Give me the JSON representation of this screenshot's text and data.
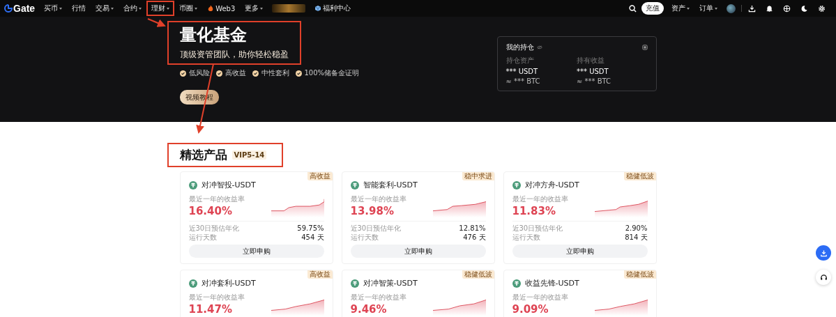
{
  "nav": {
    "logo": "Gate",
    "items": [
      {
        "label": "买币",
        "has_menu": true,
        "kind": "text",
        "annotated": false
      },
      {
        "label": "行情",
        "has_menu": false,
        "kind": "text",
        "annotated": false
      },
      {
        "label": "交易",
        "has_menu": true,
        "kind": "text",
        "annotated": false
      },
      {
        "label": "合约",
        "has_menu": true,
        "kind": "text",
        "annotated": false
      },
      {
        "label": "理财",
        "has_menu": true,
        "kind": "text",
        "annotated": true
      },
      {
        "label": "币圈",
        "has_menu": true,
        "kind": "text",
        "annotated": false
      },
      {
        "label": "Web3",
        "has_menu": false,
        "kind": "fire",
        "annotated": false
      },
      {
        "label": "更多",
        "has_menu": true,
        "kind": "text",
        "annotated": false
      },
      {
        "kind": "promo"
      },
      {
        "label": "福利中心",
        "has_menu": false,
        "kind": "gift",
        "annotated": false
      }
    ],
    "deposit": "充值",
    "right_menus": [
      {
        "label": "资产"
      },
      {
        "label": "订单"
      }
    ]
  },
  "hero": {
    "title": "量化基金",
    "subtitle": "顶级资管团队，助你轻松稳盈",
    "features": [
      "低风险",
      "高收益",
      "中性套利",
      "100%储备金证明"
    ],
    "button": "视频教程"
  },
  "holdings": {
    "title": "我的持仓",
    "columns": [
      {
        "label": "持仓资产",
        "value": "*** USDT",
        "approx": "≈ *** BTC"
      },
      {
        "label": "持有收益",
        "value": "*** USDT",
        "approx": "≈ *** BTC"
      }
    ]
  },
  "section": {
    "title": "精选产品",
    "badge": "VIP5-14"
  },
  "products": [
    {
      "tag": "高收益",
      "name": "对冲智投-USDT",
      "rate_label": "最近一年的收益率",
      "rate": "16.40%",
      "est_label": "近30日预估年化",
      "est": "59.75%",
      "days_label": "运行天数",
      "days": "454 天",
      "button": "立即申购"
    },
    {
      "tag": "稳中求进",
      "name": "智能套利-USDT",
      "rate_label": "最近一年的收益率",
      "rate": "13.98%",
      "est_label": "近30日预估年化",
      "est": "12.81%",
      "days_label": "运行天数",
      "days": "476 天",
      "button": "立即申购"
    },
    {
      "tag": "稳健低波",
      "name": "对冲方舟-USDT",
      "rate_label": "最近一年的收益率",
      "rate": "11.83%",
      "est_label": "近30日预估年化",
      "est": "2.90%",
      "days_label": "运行天数",
      "days": "814 天",
      "button": "立即申购"
    },
    {
      "tag": "高收益",
      "name": "对冲套利-USDT",
      "rate_label": "最近一年的收益率",
      "rate": "11.47%"
    },
    {
      "tag": "稳健低波",
      "name": "对冲智策-USDT",
      "rate_label": "最近一年的收益率",
      "rate": "9.46%"
    },
    {
      "tag": "稳健低波",
      "name": "收益先锋-USDT",
      "rate_label": "最近一年的收益率",
      "rate": "9.09%"
    }
  ]
}
